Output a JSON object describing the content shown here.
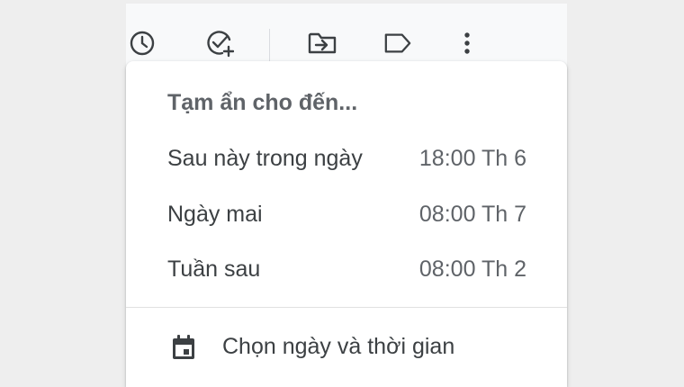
{
  "toolbar": {
    "icons": [
      {
        "name": "snooze-clock-icon"
      },
      {
        "name": "add-to-tasks-icon"
      },
      {
        "name": "move-to-folder-icon"
      },
      {
        "name": "label-icon"
      },
      {
        "name": "more-vert-icon"
      }
    ]
  },
  "snooze_menu": {
    "title": "Tạm ẩn cho đến...",
    "items": [
      {
        "label": "Sau này trong ngày",
        "time": "18:00 Th 6"
      },
      {
        "label": "Ngày mai",
        "time": "08:00 Th 7"
      },
      {
        "label": "Tuần sau",
        "time": "08:00 Th 2"
      }
    ],
    "custom": {
      "label": "Chọn ngày và thời gian",
      "icon": "calendar-icon"
    }
  },
  "colors": {
    "icon": "#3c4043",
    "title": "#5f6368",
    "text": "#3c4043",
    "menu_bg": "#ffffff",
    "toolbar_bg": "#f8f9fa"
  }
}
